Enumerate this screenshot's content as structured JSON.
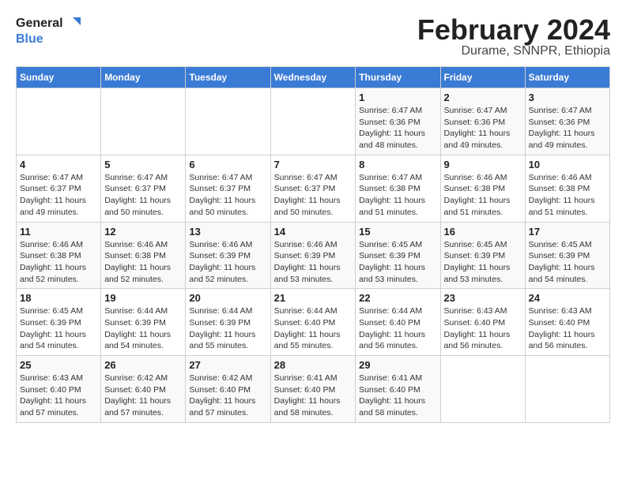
{
  "header": {
    "logo_line1": "General",
    "logo_line2": "Blue",
    "month_title": "February 2024",
    "subtitle": "Durame, SNNPR, Ethiopia"
  },
  "weekdays": [
    "Sunday",
    "Monday",
    "Tuesday",
    "Wednesday",
    "Thursday",
    "Friday",
    "Saturday"
  ],
  "weeks": [
    [
      {
        "day": "",
        "info": ""
      },
      {
        "day": "",
        "info": ""
      },
      {
        "day": "",
        "info": ""
      },
      {
        "day": "",
        "info": ""
      },
      {
        "day": "1",
        "info": "Sunrise: 6:47 AM\nSunset: 6:36 PM\nDaylight: 11 hours and 48 minutes."
      },
      {
        "day": "2",
        "info": "Sunrise: 6:47 AM\nSunset: 6:36 PM\nDaylight: 11 hours and 49 minutes."
      },
      {
        "day": "3",
        "info": "Sunrise: 6:47 AM\nSunset: 6:36 PM\nDaylight: 11 hours and 49 minutes."
      }
    ],
    [
      {
        "day": "4",
        "info": "Sunrise: 6:47 AM\nSunset: 6:37 PM\nDaylight: 11 hours and 49 minutes."
      },
      {
        "day": "5",
        "info": "Sunrise: 6:47 AM\nSunset: 6:37 PM\nDaylight: 11 hours and 50 minutes."
      },
      {
        "day": "6",
        "info": "Sunrise: 6:47 AM\nSunset: 6:37 PM\nDaylight: 11 hours and 50 minutes."
      },
      {
        "day": "7",
        "info": "Sunrise: 6:47 AM\nSunset: 6:37 PM\nDaylight: 11 hours and 50 minutes."
      },
      {
        "day": "8",
        "info": "Sunrise: 6:47 AM\nSunset: 6:38 PM\nDaylight: 11 hours and 51 minutes."
      },
      {
        "day": "9",
        "info": "Sunrise: 6:46 AM\nSunset: 6:38 PM\nDaylight: 11 hours and 51 minutes."
      },
      {
        "day": "10",
        "info": "Sunrise: 6:46 AM\nSunset: 6:38 PM\nDaylight: 11 hours and 51 minutes."
      }
    ],
    [
      {
        "day": "11",
        "info": "Sunrise: 6:46 AM\nSunset: 6:38 PM\nDaylight: 11 hours and 52 minutes."
      },
      {
        "day": "12",
        "info": "Sunrise: 6:46 AM\nSunset: 6:38 PM\nDaylight: 11 hours and 52 minutes."
      },
      {
        "day": "13",
        "info": "Sunrise: 6:46 AM\nSunset: 6:39 PM\nDaylight: 11 hours and 52 minutes."
      },
      {
        "day": "14",
        "info": "Sunrise: 6:46 AM\nSunset: 6:39 PM\nDaylight: 11 hours and 53 minutes."
      },
      {
        "day": "15",
        "info": "Sunrise: 6:45 AM\nSunset: 6:39 PM\nDaylight: 11 hours and 53 minutes."
      },
      {
        "day": "16",
        "info": "Sunrise: 6:45 AM\nSunset: 6:39 PM\nDaylight: 11 hours and 53 minutes."
      },
      {
        "day": "17",
        "info": "Sunrise: 6:45 AM\nSunset: 6:39 PM\nDaylight: 11 hours and 54 minutes."
      }
    ],
    [
      {
        "day": "18",
        "info": "Sunrise: 6:45 AM\nSunset: 6:39 PM\nDaylight: 11 hours and 54 minutes."
      },
      {
        "day": "19",
        "info": "Sunrise: 6:44 AM\nSunset: 6:39 PM\nDaylight: 11 hours and 54 minutes."
      },
      {
        "day": "20",
        "info": "Sunrise: 6:44 AM\nSunset: 6:39 PM\nDaylight: 11 hours and 55 minutes."
      },
      {
        "day": "21",
        "info": "Sunrise: 6:44 AM\nSunset: 6:40 PM\nDaylight: 11 hours and 55 minutes."
      },
      {
        "day": "22",
        "info": "Sunrise: 6:44 AM\nSunset: 6:40 PM\nDaylight: 11 hours and 56 minutes."
      },
      {
        "day": "23",
        "info": "Sunrise: 6:43 AM\nSunset: 6:40 PM\nDaylight: 11 hours and 56 minutes."
      },
      {
        "day": "24",
        "info": "Sunrise: 6:43 AM\nSunset: 6:40 PM\nDaylight: 11 hours and 56 minutes."
      }
    ],
    [
      {
        "day": "25",
        "info": "Sunrise: 6:43 AM\nSunset: 6:40 PM\nDaylight: 11 hours and 57 minutes."
      },
      {
        "day": "26",
        "info": "Sunrise: 6:42 AM\nSunset: 6:40 PM\nDaylight: 11 hours and 57 minutes."
      },
      {
        "day": "27",
        "info": "Sunrise: 6:42 AM\nSunset: 6:40 PM\nDaylight: 11 hours and 57 minutes."
      },
      {
        "day": "28",
        "info": "Sunrise: 6:41 AM\nSunset: 6:40 PM\nDaylight: 11 hours and 58 minutes."
      },
      {
        "day": "29",
        "info": "Sunrise: 6:41 AM\nSunset: 6:40 PM\nDaylight: 11 hours and 58 minutes."
      },
      {
        "day": "",
        "info": ""
      },
      {
        "day": "",
        "info": ""
      }
    ]
  ]
}
